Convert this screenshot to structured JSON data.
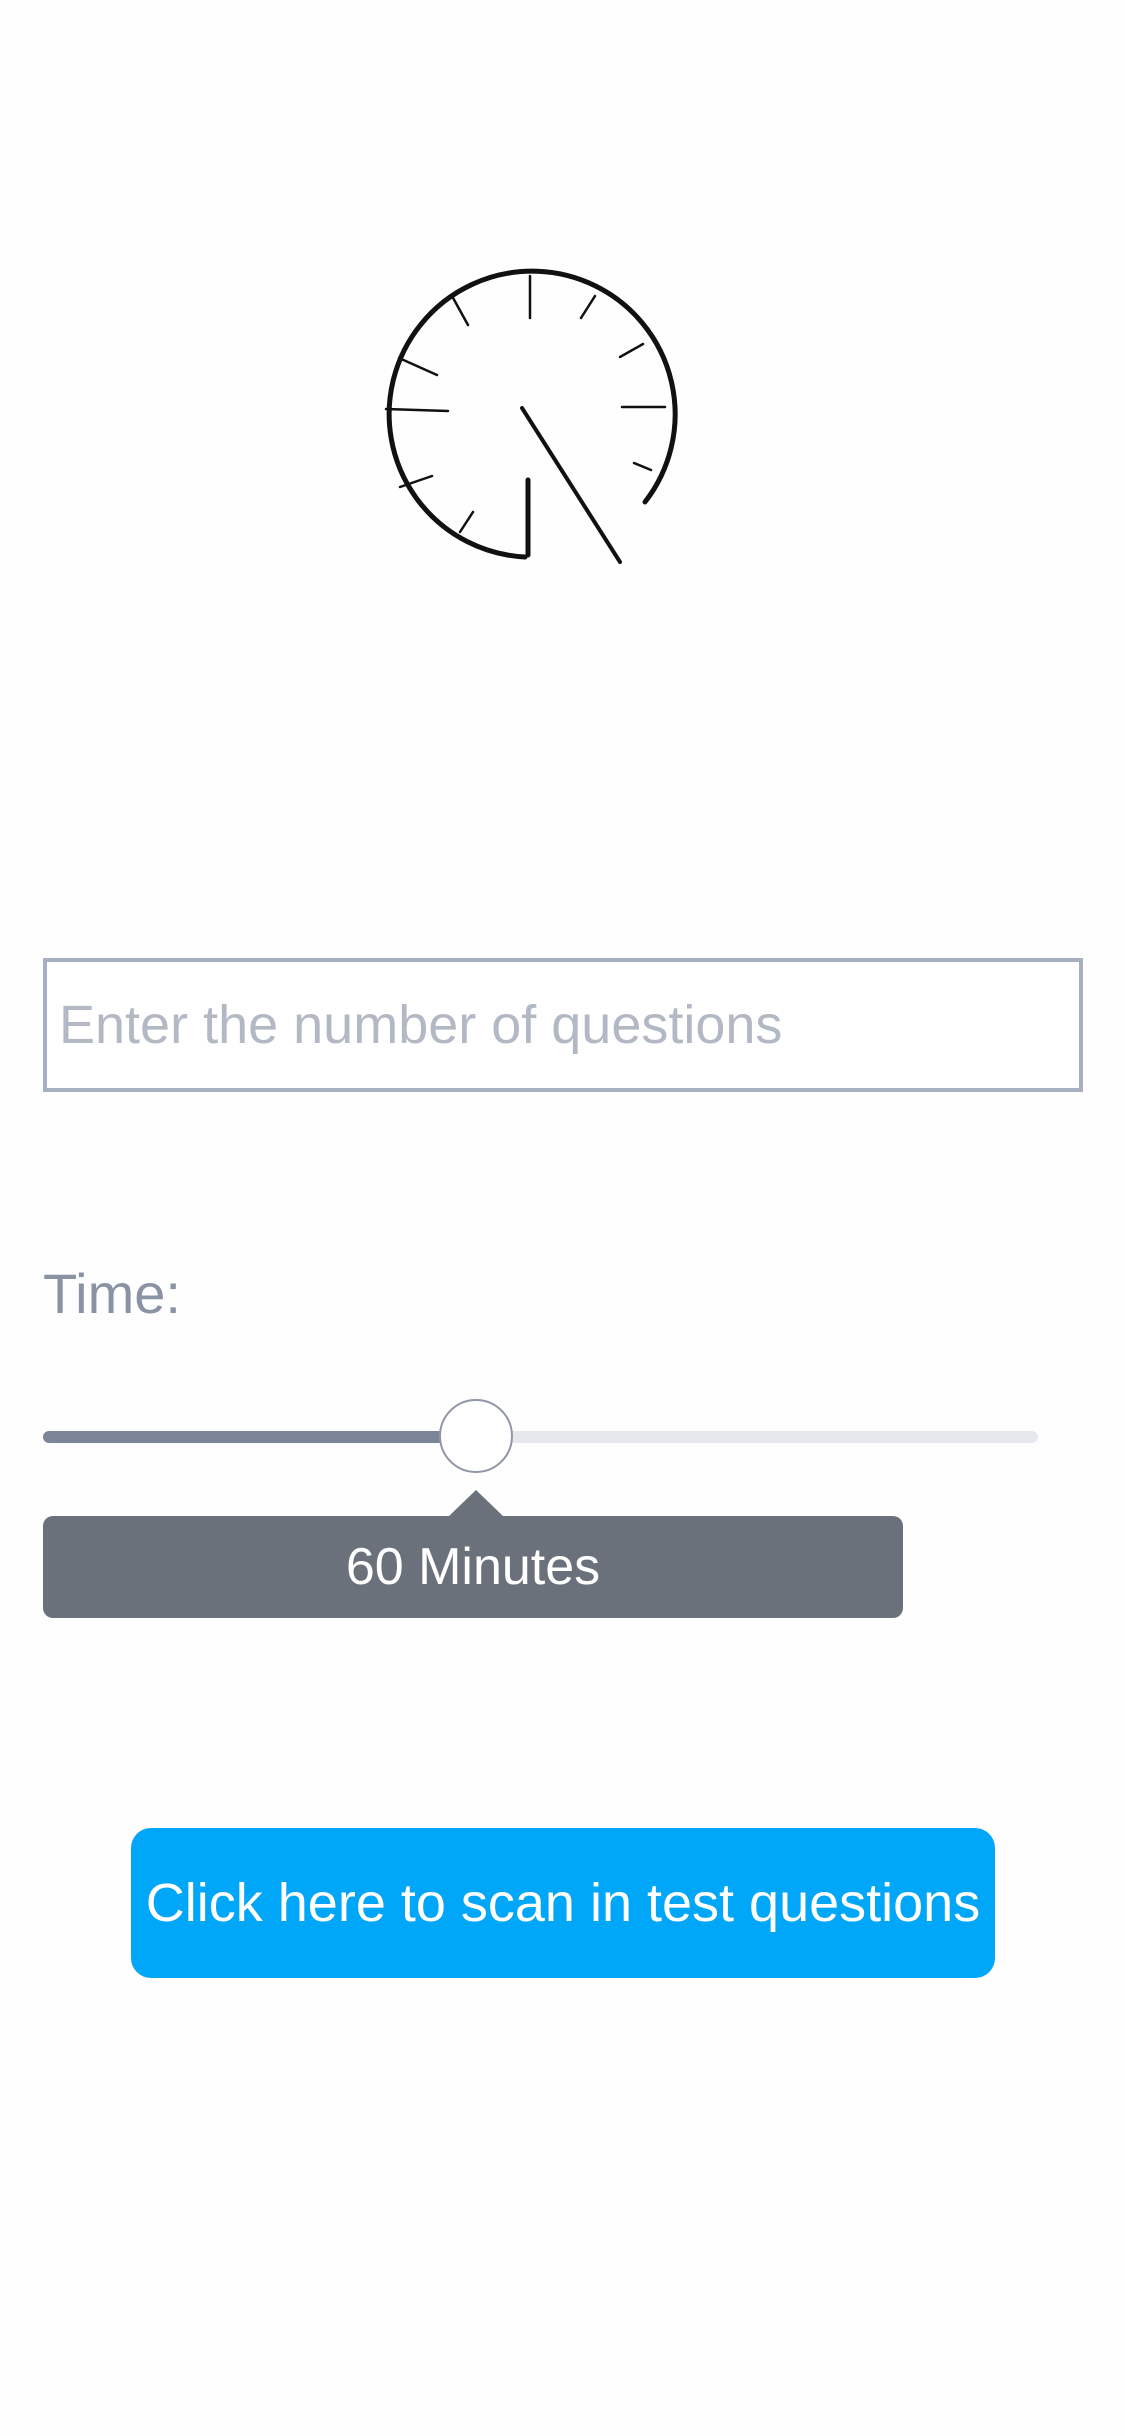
{
  "logo": {
    "icon": "clock-icon"
  },
  "form": {
    "questions_placeholder": "Enter the number of questions",
    "questions_value": "",
    "time_label": "Time:",
    "time_slider": {
      "fraction": 0.435,
      "tooltip": "60 Minutes"
    }
  },
  "actions": {
    "scan_button_label": "Click here to scan in test questions"
  },
  "colors": {
    "primary": "#00a6f8",
    "tooltip": "#6b717b",
    "slider_fill": "#7c8597",
    "slider_track": "#e6e8ee",
    "input_border": "#a7b0bf"
  }
}
